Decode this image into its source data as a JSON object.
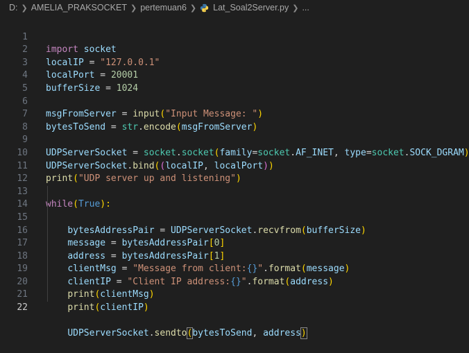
{
  "breadcrumb": {
    "drive": "D:",
    "folder1": "AMELIA_PRAKSOCKET",
    "folder2": "pertemuan6",
    "file": "Lat_Soal2Server.py",
    "more": "..."
  },
  "line_numbers": [
    "1",
    "2",
    "3",
    "4",
    "5",
    "6",
    "7",
    "8",
    "9",
    "10",
    "11",
    "12",
    "13",
    "14",
    "15",
    "16",
    "17",
    "18",
    "19",
    "20",
    "21",
    "22"
  ],
  "code": {
    "l1": [
      "import",
      " ",
      "socket"
    ],
    "l2": [
      "localIP",
      " = ",
      "\"127.0.0.1\""
    ],
    "l3": [
      "localPort",
      " = ",
      "20001"
    ],
    "l4": [
      "bufferSize",
      " = ",
      "1024"
    ],
    "l6": [
      "msgFromServer",
      " = ",
      "input",
      "(",
      "\"Input Message: \"",
      ")"
    ],
    "l7": [
      "bytesToSend",
      " = ",
      "str",
      ".",
      "encode",
      "(",
      "msgFromServer",
      ")"
    ],
    "l9": [
      "UDPServerSocket",
      " = ",
      "socket",
      ".",
      "socket",
      "(",
      "family",
      "=",
      "socket",
      ".",
      "AF_INET",
      ", ",
      "type",
      "=",
      "socket",
      ".",
      "SOCK_DGRAM",
      ")"
    ],
    "l10": [
      "UDPServerSocket",
      ".",
      "bind",
      "(",
      "(",
      "localIP",
      ", ",
      "localPort",
      ")",
      ")"
    ],
    "l11": [
      "print",
      "(",
      "\"UDP server up and listening\"",
      ")"
    ],
    "l13": [
      "while",
      "(",
      "True",
      "):"
    ],
    "l14": [
      "    ",
      "bytesAddressPair",
      " = ",
      "UDPServerSocket",
      ".",
      "recvfrom",
      "(",
      "bufferSize",
      ")"
    ],
    "l15": [
      "    ",
      "message",
      " = ",
      "bytesAddressPair",
      "[",
      "0",
      "]"
    ],
    "l16": [
      "    ",
      "address",
      " = ",
      "bytesAddressPair",
      "[",
      "1",
      "]"
    ],
    "l17": [
      "    ",
      "clientMsg",
      " = ",
      "\"Message from client:",
      "{}",
      "\"",
      ".",
      "format",
      "(",
      "message",
      ")"
    ],
    "l18": [
      "    ",
      "clientIP",
      " = ",
      "\"Client IP address:",
      "{}",
      "\"",
      ".",
      "format",
      "(",
      "address",
      ")"
    ],
    "l19": [
      "    ",
      "print",
      "(",
      "clientMsg",
      ")"
    ],
    "l20": [
      "    ",
      "print",
      "(",
      "clientIP",
      ")"
    ],
    "l22": [
      "    ",
      "UDPServerSocket",
      ".",
      "sendto",
      "(",
      "bytesToSend",
      ", ",
      "address",
      ")"
    ]
  },
  "colors": {
    "background": "#1f1f1f",
    "keyword": "#c586c0",
    "string": "#ce9178",
    "function": "#dcdcaa",
    "variable": "#9cdcfe",
    "number": "#b5cea8"
  }
}
